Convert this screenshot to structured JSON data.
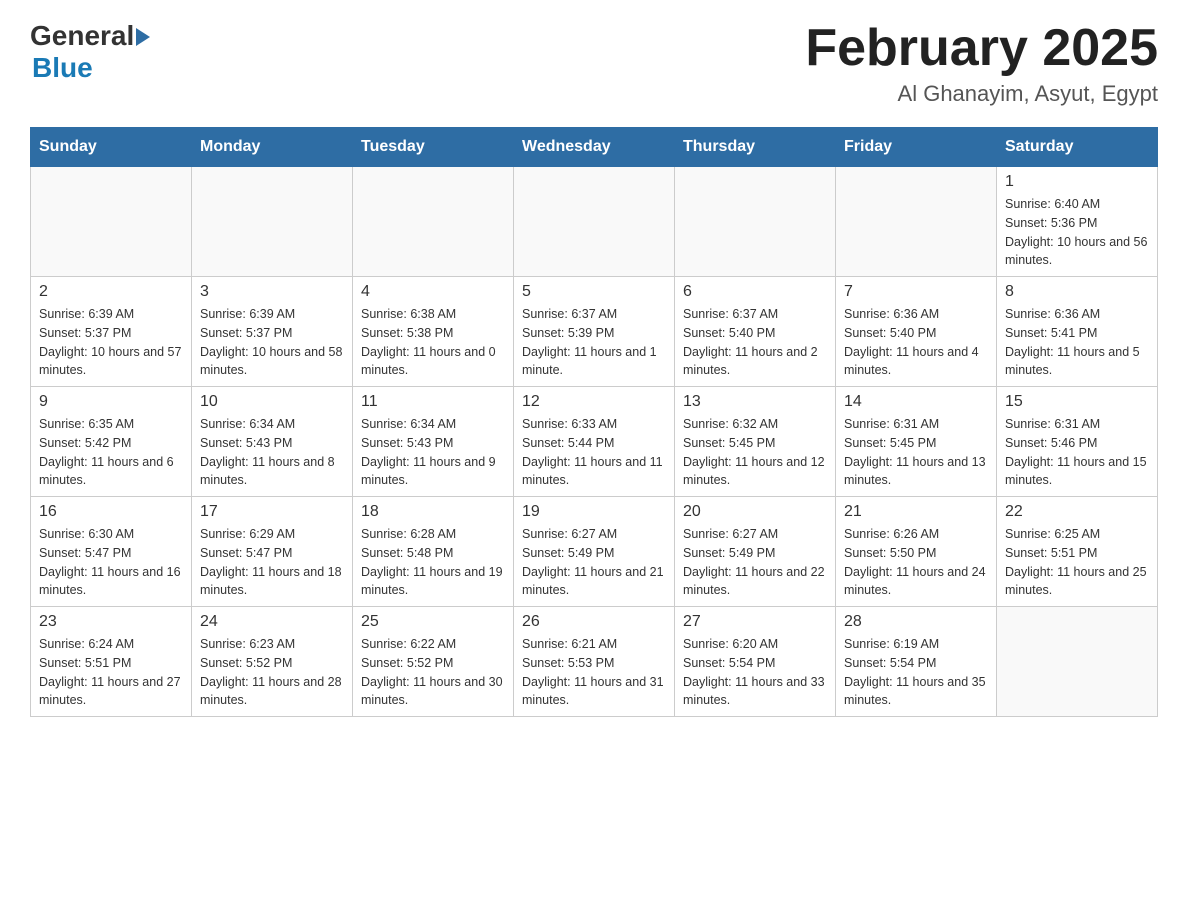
{
  "header": {
    "logo_general": "General",
    "logo_blue": "Blue",
    "title": "February 2025",
    "subtitle": "Al Ghanayim, Asyut, Egypt"
  },
  "days_of_week": [
    "Sunday",
    "Monday",
    "Tuesday",
    "Wednesday",
    "Thursday",
    "Friday",
    "Saturday"
  ],
  "weeks": [
    [
      {
        "day": "",
        "info": ""
      },
      {
        "day": "",
        "info": ""
      },
      {
        "day": "",
        "info": ""
      },
      {
        "day": "",
        "info": ""
      },
      {
        "day": "",
        "info": ""
      },
      {
        "day": "",
        "info": ""
      },
      {
        "day": "1",
        "info": "Sunrise: 6:40 AM\nSunset: 5:36 PM\nDaylight: 10 hours and 56 minutes."
      }
    ],
    [
      {
        "day": "2",
        "info": "Sunrise: 6:39 AM\nSunset: 5:37 PM\nDaylight: 10 hours and 57 minutes."
      },
      {
        "day": "3",
        "info": "Sunrise: 6:39 AM\nSunset: 5:37 PM\nDaylight: 10 hours and 58 minutes."
      },
      {
        "day": "4",
        "info": "Sunrise: 6:38 AM\nSunset: 5:38 PM\nDaylight: 11 hours and 0 minutes."
      },
      {
        "day": "5",
        "info": "Sunrise: 6:37 AM\nSunset: 5:39 PM\nDaylight: 11 hours and 1 minute."
      },
      {
        "day": "6",
        "info": "Sunrise: 6:37 AM\nSunset: 5:40 PM\nDaylight: 11 hours and 2 minutes."
      },
      {
        "day": "7",
        "info": "Sunrise: 6:36 AM\nSunset: 5:40 PM\nDaylight: 11 hours and 4 minutes."
      },
      {
        "day": "8",
        "info": "Sunrise: 6:36 AM\nSunset: 5:41 PM\nDaylight: 11 hours and 5 minutes."
      }
    ],
    [
      {
        "day": "9",
        "info": "Sunrise: 6:35 AM\nSunset: 5:42 PM\nDaylight: 11 hours and 6 minutes."
      },
      {
        "day": "10",
        "info": "Sunrise: 6:34 AM\nSunset: 5:43 PM\nDaylight: 11 hours and 8 minutes."
      },
      {
        "day": "11",
        "info": "Sunrise: 6:34 AM\nSunset: 5:43 PM\nDaylight: 11 hours and 9 minutes."
      },
      {
        "day": "12",
        "info": "Sunrise: 6:33 AM\nSunset: 5:44 PM\nDaylight: 11 hours and 11 minutes."
      },
      {
        "day": "13",
        "info": "Sunrise: 6:32 AM\nSunset: 5:45 PM\nDaylight: 11 hours and 12 minutes."
      },
      {
        "day": "14",
        "info": "Sunrise: 6:31 AM\nSunset: 5:45 PM\nDaylight: 11 hours and 13 minutes."
      },
      {
        "day": "15",
        "info": "Sunrise: 6:31 AM\nSunset: 5:46 PM\nDaylight: 11 hours and 15 minutes."
      }
    ],
    [
      {
        "day": "16",
        "info": "Sunrise: 6:30 AM\nSunset: 5:47 PM\nDaylight: 11 hours and 16 minutes."
      },
      {
        "day": "17",
        "info": "Sunrise: 6:29 AM\nSunset: 5:47 PM\nDaylight: 11 hours and 18 minutes."
      },
      {
        "day": "18",
        "info": "Sunrise: 6:28 AM\nSunset: 5:48 PM\nDaylight: 11 hours and 19 minutes."
      },
      {
        "day": "19",
        "info": "Sunrise: 6:27 AM\nSunset: 5:49 PM\nDaylight: 11 hours and 21 minutes."
      },
      {
        "day": "20",
        "info": "Sunrise: 6:27 AM\nSunset: 5:49 PM\nDaylight: 11 hours and 22 minutes."
      },
      {
        "day": "21",
        "info": "Sunrise: 6:26 AM\nSunset: 5:50 PM\nDaylight: 11 hours and 24 minutes."
      },
      {
        "day": "22",
        "info": "Sunrise: 6:25 AM\nSunset: 5:51 PM\nDaylight: 11 hours and 25 minutes."
      }
    ],
    [
      {
        "day": "23",
        "info": "Sunrise: 6:24 AM\nSunset: 5:51 PM\nDaylight: 11 hours and 27 minutes."
      },
      {
        "day": "24",
        "info": "Sunrise: 6:23 AM\nSunset: 5:52 PM\nDaylight: 11 hours and 28 minutes."
      },
      {
        "day": "25",
        "info": "Sunrise: 6:22 AM\nSunset: 5:52 PM\nDaylight: 11 hours and 30 minutes."
      },
      {
        "day": "26",
        "info": "Sunrise: 6:21 AM\nSunset: 5:53 PM\nDaylight: 11 hours and 31 minutes."
      },
      {
        "day": "27",
        "info": "Sunrise: 6:20 AM\nSunset: 5:54 PM\nDaylight: 11 hours and 33 minutes."
      },
      {
        "day": "28",
        "info": "Sunrise: 6:19 AM\nSunset: 5:54 PM\nDaylight: 11 hours and 35 minutes."
      },
      {
        "day": "",
        "info": ""
      }
    ]
  ]
}
